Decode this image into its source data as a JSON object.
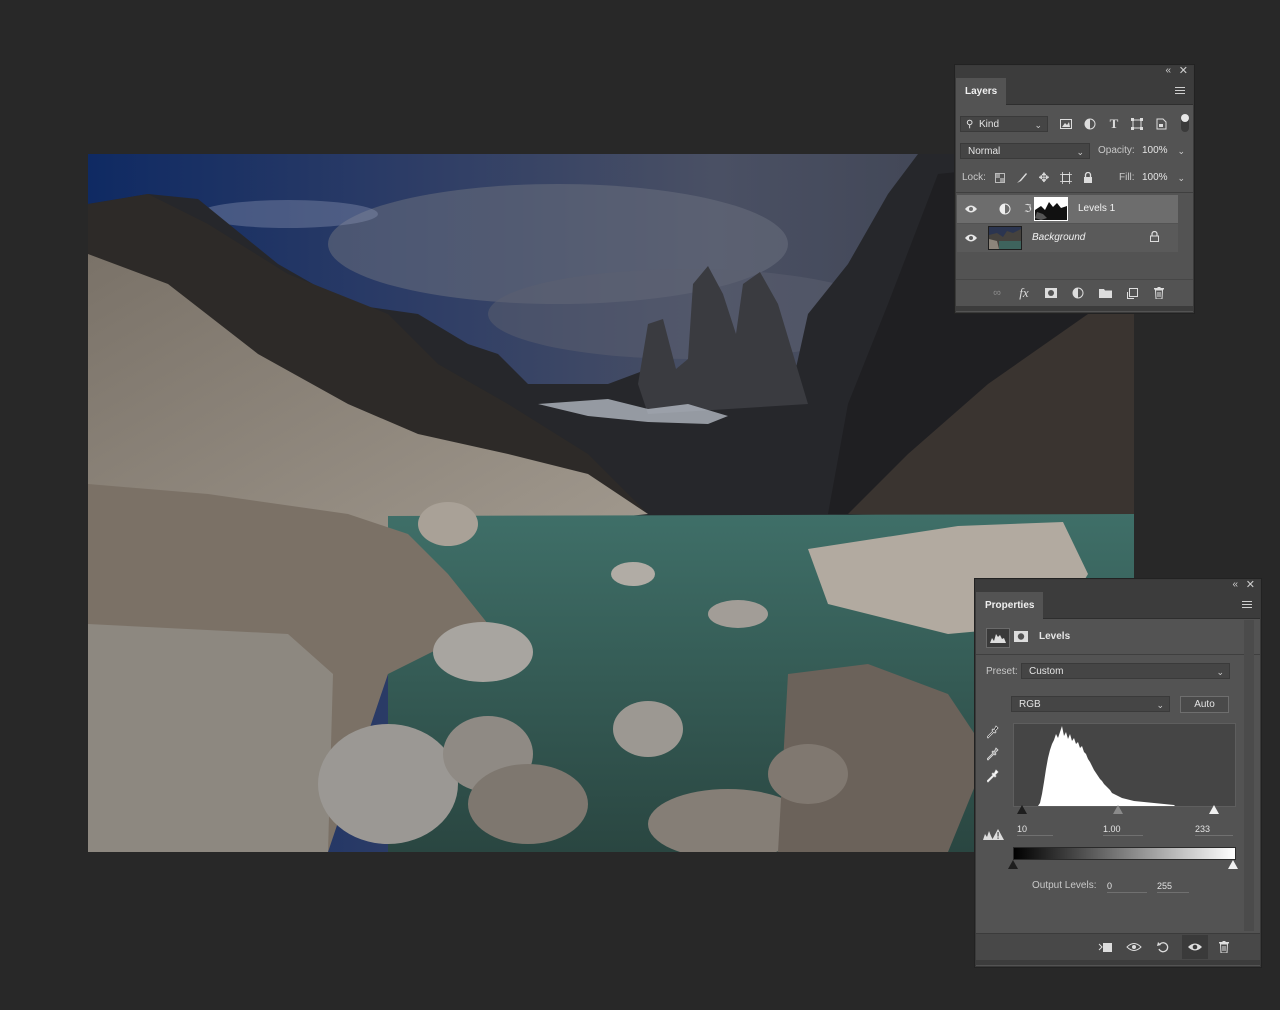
{
  "layers_panel": {
    "tab_label": "Layers",
    "filter_kind": "Kind",
    "blend_mode": "Normal",
    "opacity_label": "Opacity:",
    "opacity_value": "100%",
    "lock_label": "Lock:",
    "fill_label": "Fill:",
    "fill_value": "100%",
    "layers": [
      {
        "name": "Levels 1",
        "selected": true
      },
      {
        "name": "Background",
        "locked": true
      }
    ]
  },
  "properties_panel": {
    "tab_label": "Properties",
    "adjustment_title": "Levels",
    "preset_label": "Preset:",
    "preset_value": "Custom",
    "channel_value": "RGB",
    "auto_label": "Auto",
    "input_black": "10",
    "input_gamma": "1.00",
    "input_white": "233",
    "output_label": "Output Levels:",
    "output_black": "0",
    "output_white": "255"
  },
  "colors": {
    "panel": "#535353",
    "tab_bar": "#3c3c3c",
    "app_bg": "#282828",
    "selected_row": "#6d6d6d"
  }
}
